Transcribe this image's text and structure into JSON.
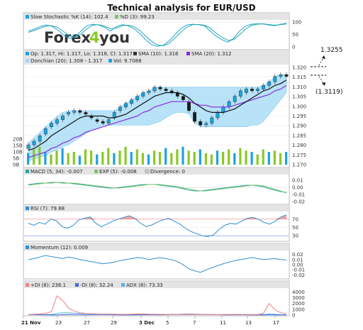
{
  "title": "Technical analysis for EUR/USD",
  "logo": {
    "text_forex": "Forex",
    "text_4": "4",
    "text_you": "you"
  },
  "annotations": {
    "upper": "1.3255",
    "lower": "(1.3119)"
  },
  "x_axis": {
    "labels": [
      "21 Nov",
      "23",
      "27",
      "29",
      "3 Dec",
      "5",
      "7",
      "11",
      "13",
      "17"
    ]
  },
  "colors": {
    "up": "#1aa3e0",
    "down": "#222222",
    "donchian": "#9fd8f5",
    "sma10": "#111111",
    "sma20": "#8a2be2",
    "macd": "#2aa7a0",
    "exp": "#7ac36a",
    "rsi": "#2d8fd5",
    "di_plus": "#f08080",
    "di_minus": "#4169e1",
    "adx": "#5bb0e8",
    "vol": "#8ac926"
  },
  "chart_data": [
    {
      "type": "line",
      "panel": "stochastic",
      "legend": [
        "Slow Stochastic %K (14): 102.4",
        "%D (3): 99.23"
      ],
      "y_ticks": [
        "100",
        "50",
        "0"
      ],
      "ylim": [
        0,
        110
      ],
      "series": [
        {
          "name": "Slow Stochastic %K (14)",
          "values": [
            70,
            78,
            88,
            95,
            90,
            75,
            55,
            40,
            48,
            70,
            92,
            98,
            95,
            85,
            70,
            88,
            96,
            92,
            80,
            60,
            35,
            15,
            8,
            12,
            30,
            55,
            80,
            95,
            98,
            96,
            92,
            70,
            50,
            35,
            25,
            40,
            70,
            90,
            98,
            100,
            99,
            95,
            92,
            98,
            102
          ]
        },
        {
          "name": "%D (3)",
          "values": [
            65,
            72,
            82,
            90,
            92,
            85,
            68,
            52,
            46,
            58,
            80,
            94,
            96,
            90,
            80,
            82,
            92,
            94,
            88,
            72,
            50,
            28,
            14,
            10,
            20,
            42,
            66,
            86,
            96,
            97,
            94,
            82,
            62,
            45,
            32,
            35,
            55,
            78,
            93,
            98,
            100,
            97,
            94,
            96,
            99
          ]
        }
      ]
    },
    {
      "type": "candlestick",
      "panel": "price",
      "legend": [
        "Op: 1.317, Hi: 1.317, Lo: 1.318, Cl: 1.317",
        "SMA (10): 1.316",
        "SMA (20): 1.312",
        "Donchian (20): 1.308 - 1.317",
        "Vol: 9.7088"
      ],
      "y_ticks": [
        "1.320",
        "1.315",
        "1.310",
        "1.305",
        "1.300",
        "1.295",
        "1.290",
        "1.285",
        "1.280",
        "1.275",
        "1.270"
      ],
      "ylim": [
        1.268,
        1.322
      ],
      "close": [
        1.279,
        1.281,
        1.284,
        1.288,
        1.291,
        1.293,
        1.295,
        1.297,
        1.298,
        1.297,
        1.296,
        1.294,
        1.292,
        1.291,
        1.293,
        1.297,
        1.3,
        1.302,
        1.304,
        1.306,
        1.308,
        1.309,
        1.311,
        1.31,
        1.309,
        1.308,
        1.306,
        1.304,
        1.298,
        1.292,
        1.29,
        1.291,
        1.294,
        1.297,
        1.3,
        1.303,
        1.306,
        1.309,
        1.31,
        1.309,
        1.31,
        1.312,
        1.314,
        1.317,
        1.318,
        1.317
      ],
      "open": [
        1.277,
        1.279,
        1.281,
        1.285,
        1.289,
        1.291,
        1.293,
        1.296,
        1.297,
        1.298,
        1.297,
        1.295,
        1.293,
        1.292,
        1.291,
        1.294,
        1.298,
        1.3,
        1.302,
        1.304,
        1.306,
        1.308,
        1.309,
        1.311,
        1.31,
        1.309,
        1.308,
        1.306,
        1.303,
        1.297,
        1.292,
        1.29,
        1.291,
        1.294,
        1.297,
        1.3,
        1.303,
        1.306,
        1.308,
        1.31,
        1.309,
        1.31,
        1.312,
        1.314,
        1.317,
        1.318
      ],
      "sma10": [
        1.276,
        1.277,
        1.279,
        1.281,
        1.284,
        1.286,
        1.288,
        1.29,
        1.292,
        1.294,
        1.295,
        1.295,
        1.295,
        1.295,
        1.294,
        1.294,
        1.295,
        1.296,
        1.298,
        1.3,
        1.302,
        1.304,
        1.306,
        1.307,
        1.308,
        1.308,
        1.308,
        1.307,
        1.305,
        1.302,
        1.3,
        1.298,
        1.297,
        1.297,
        1.297,
        1.298,
        1.299,
        1.301,
        1.303,
        1.305,
        1.307,
        1.309,
        1.31,
        1.312,
        1.313,
        1.315
      ],
      "sma20": [
        1.272,
        1.273,
        1.274,
        1.275,
        1.277,
        1.278,
        1.28,
        1.281,
        1.283,
        1.284,
        1.286,
        1.287,
        1.288,
        1.289,
        1.29,
        1.291,
        1.292,
        1.293,
        1.294,
        1.295,
        1.297,
        1.298,
        1.3,
        1.301,
        1.302,
        1.303,
        1.303,
        1.303,
        1.303,
        1.302,
        1.301,
        1.301,
        1.3,
        1.3,
        1.3,
        1.3,
        1.301,
        1.302,
        1.303,
        1.304,
        1.305,
        1.306,
        1.307,
        1.309,
        1.31,
        1.312
      ],
      "donchian_hi": [
        1.28,
        1.283,
        1.286,
        1.289,
        1.292,
        1.295,
        1.297,
        1.298,
        1.298,
        1.298,
        1.298,
        1.298,
        1.298,
        1.298,
        1.298,
        1.298,
        1.3,
        1.302,
        1.304,
        1.306,
        1.308,
        1.309,
        1.311,
        1.311,
        1.311,
        1.311,
        1.311,
        1.311,
        1.311,
        1.311,
        1.311,
        1.311,
        1.311,
        1.311,
        1.311,
        1.311,
        1.311,
        1.311,
        1.311,
        1.311,
        1.311,
        1.312,
        1.314,
        1.317,
        1.318,
        1.318
      ],
      "donchian_lo": [
        1.27,
        1.271,
        1.272,
        1.273,
        1.275,
        1.276,
        1.278,
        1.279,
        1.281,
        1.283,
        1.285,
        1.287,
        1.288,
        1.29,
        1.29,
        1.29,
        1.29,
        1.29,
        1.29,
        1.29,
        1.29,
        1.29,
        1.291,
        1.292,
        1.294,
        1.296,
        1.297,
        1.297,
        1.296,
        1.291,
        1.289,
        1.289,
        1.289,
        1.289,
        1.289,
        1.289,
        1.289,
        1.289,
        1.289,
        1.29,
        1.29,
        1.292,
        1.296,
        1.3,
        1.304,
        1.308
      ],
      "volume_ticks": [
        "20B",
        "15B",
        "10B",
        "5B",
        "0B"
      ],
      "volume": [
        9,
        12,
        14,
        10,
        8,
        11,
        13,
        9,
        10,
        7,
        12,
        11,
        8,
        10,
        13,
        9,
        11,
        14,
        10,
        12,
        9,
        8,
        11,
        10,
        13,
        9,
        12,
        14,
        11,
        10,
        12,
        9,
        8,
        11,
        10,
        12,
        9,
        13,
        11,
        10,
        8,
        12,
        10,
        11,
        9,
        10
      ]
    },
    {
      "type": "line",
      "panel": "macd",
      "legend": [
        "MACD (5, 34): -0.007",
        "EXP (5): -0.008",
        "Divergence: 0"
      ],
      "y_ticks": [
        "0.01",
        "0.00",
        "-0.01",
        "-0.02"
      ],
      "ylim": [
        -0.022,
        0.016
      ],
      "series": [
        {
          "name": "MACD (5, 34)",
          "values": [
            0.004,
            0.005,
            0.006,
            0.006,
            0.007,
            0.007,
            0.006,
            0.006,
            0.005,
            0.004,
            0.003,
            0.002,
            0.001,
            0.0,
            -0.001,
            -0.001,
            0.0,
            0.001,
            0.002,
            0.003,
            0.004,
            0.004,
            0.004,
            0.003,
            0.002,
            0.001,
            0.0,
            -0.002,
            -0.004,
            -0.005,
            -0.005,
            -0.004,
            -0.003,
            -0.002,
            -0.001,
            0.0,
            0.001,
            0.002,
            0.003,
            0.003,
            0.002,
            0.001,
            -0.002,
            -0.004,
            -0.006,
            -0.007
          ]
        },
        {
          "name": "EXP (5)",
          "values": [
            0.003,
            0.004,
            0.005,
            0.006,
            0.006,
            0.007,
            0.007,
            0.006,
            0.006,
            0.005,
            0.004,
            0.003,
            0.002,
            0.001,
            0.0,
            -0.001,
            -0.001,
            0.0,
            0.001,
            0.002,
            0.003,
            0.004,
            0.004,
            0.004,
            0.003,
            0.002,
            0.001,
            -0.001,
            -0.002,
            -0.004,
            -0.005,
            -0.005,
            -0.004,
            -0.003,
            -0.002,
            -0.001,
            0.0,
            0.001,
            0.002,
            0.003,
            0.003,
            0.002,
            0.0,
            -0.003,
            -0.005,
            -0.008
          ]
        }
      ]
    },
    {
      "type": "line",
      "panel": "rsi",
      "legend": [
        "RSI (7): 79.88"
      ],
      "y_ticks": [
        "70",
        "50",
        "30"
      ],
      "ylim": [
        20,
        85
      ],
      "series": [
        {
          "name": "RSI (7)",
          "values": [
            60,
            55,
            62,
            58,
            70,
            66,
            52,
            48,
            55,
            68,
            72,
            75,
            60,
            52,
            58,
            65,
            70,
            74,
            78,
            72,
            60,
            52,
            56,
            63,
            68,
            72,
            65,
            58,
            48,
            40,
            35,
            30,
            28,
            32,
            45,
            55,
            60,
            58,
            65,
            72,
            74,
            70,
            62,
            58,
            65,
            75,
            80
          ]
        }
      ]
    },
    {
      "type": "line",
      "panel": "momentum",
      "legend": [
        "Momentum (12): 0.009"
      ],
      "y_ticks": [
        "0.02",
        "0.01",
        "0.00",
        "-0.01",
        "-0.02"
      ],
      "ylim": [
        -0.025,
        0.025
      ],
      "series": [
        {
          "name": "Momentum (12)",
          "values": [
            0.01,
            0.012,
            0.015,
            0.018,
            0.016,
            0.014,
            0.012,
            0.015,
            0.013,
            0.01,
            0.008,
            0.006,
            0.004,
            0.002,
            0.003,
            0.005,
            0.008,
            0.01,
            0.012,
            0.014,
            0.013,
            0.01,
            0.012,
            0.014,
            0.012,
            0.01,
            0.006,
            0.0,
            -0.008,
            -0.012,
            -0.015,
            -0.01,
            -0.006,
            -0.002,
            0.002,
            0.005,
            0.008,
            0.01,
            0.012,
            0.014,
            0.012,
            0.01,
            0.011,
            0.012,
            0.01,
            0.009
          ]
        }
      ]
    },
    {
      "type": "line",
      "panel": "dmi",
      "legend": [
        "+DI (8): 236.1",
        "-DI (8): 32.24",
        "ADX (8): 73.33"
      ],
      "y_ticks": [
        "4000",
        "3000",
        "2000",
        "1000",
        "0"
      ],
      "ylim": [
        0,
        4400
      ],
      "series": [
        {
          "name": "+DI (8)",
          "values": [
            100,
            150,
            200,
            300,
            600,
            3300,
            2500,
            1200,
            700,
            400,
            300,
            250,
            200,
            180,
            150,
            130,
            120,
            110,
            150,
            200,
            180,
            160,
            140,
            120,
            100,
            90,
            80,
            100,
            120,
            100,
            90,
            80,
            70,
            60,
            80,
            100,
            120,
            100,
            90,
            80,
            100,
            300,
            2000,
            900,
            400,
            236
          ]
        },
        {
          "name": "-DI (8)",
          "values": [
            80,
            90,
            60,
            50,
            40,
            40,
            60,
            80,
            100,
            70,
            50,
            60,
            80,
            100,
            60,
            50,
            40,
            30,
            40,
            50,
            60,
            70,
            60,
            50,
            60,
            90,
            120,
            150,
            180,
            160,
            120,
            90,
            70,
            60,
            50,
            40,
            50,
            60,
            50,
            40,
            30,
            40,
            50,
            40,
            35,
            32
          ]
        },
        {
          "name": "ADX (8)",
          "values": [
            60,
            65,
            70,
            80,
            120,
            300,
            400,
            380,
            330,
            280,
            240,
            210,
            190,
            170,
            160,
            150,
            140,
            130,
            125,
            130,
            135,
            130,
            125,
            120,
            115,
            110,
            105,
            100,
            105,
            110,
            108,
            100,
            95,
            90,
            88,
            90,
            92,
            90,
            88,
            86,
            85,
            100,
            180,
            130,
            90,
            73
          ]
        }
      ]
    }
  ]
}
